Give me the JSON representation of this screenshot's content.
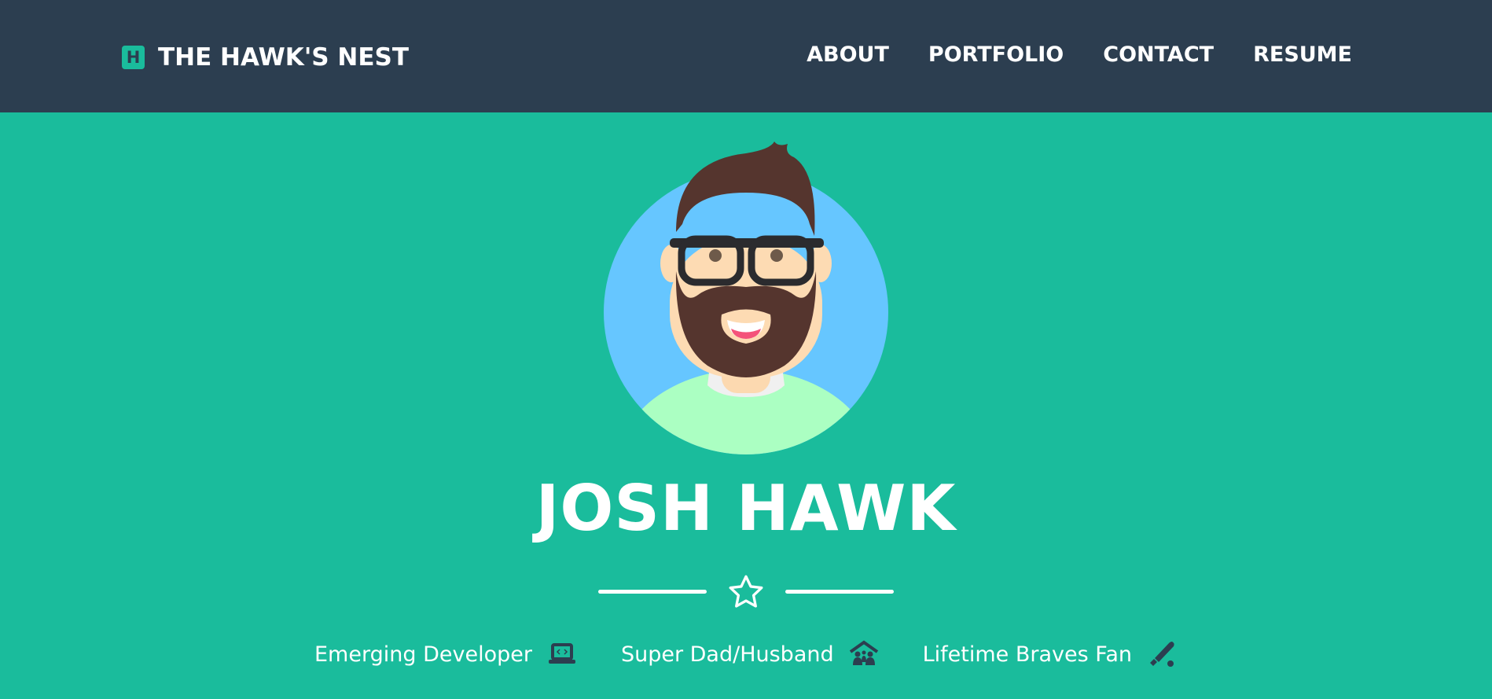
{
  "nav": {
    "logo_letter": "H",
    "brand": "THE HAWK'S NEST",
    "links": [
      "ABOUT",
      "PORTFOLIO",
      "CONTACT",
      "RESUME"
    ]
  },
  "hero": {
    "name": "JOSH HAWK",
    "divider_icon": "star-outline-icon",
    "tags": [
      {
        "label": "Emerging Developer",
        "icon": "laptop-code-icon"
      },
      {
        "label": "Super Dad/Husband",
        "icon": "house-family-icon"
      },
      {
        "label": "Lifetime Braves Fan",
        "icon": "baseball-bat-icon"
      }
    ]
  },
  "colors": {
    "nav_bg": "#2c3e50",
    "accent": "#1abc9c",
    "avatar_bg": "#66c6ff"
  }
}
